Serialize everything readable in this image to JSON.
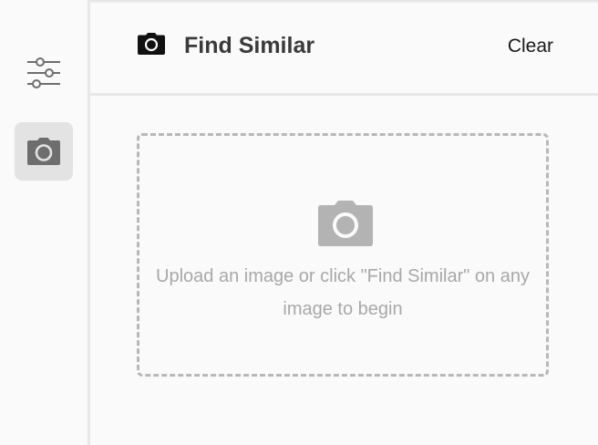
{
  "header": {
    "title": "Find Similar",
    "clear_label": "Clear",
    "icon": "camera-icon"
  },
  "rail": {
    "items": [
      {
        "icon": "sliders-icon",
        "active": false
      },
      {
        "icon": "camera-icon",
        "active": true
      }
    ]
  },
  "dropzone": {
    "icon": "camera-icon",
    "message": "Upload an image or click \"Find Similar\" on any image to begin"
  },
  "colors": {
    "background": "#fafafa",
    "active_rail_bg": "#e3e3e3",
    "dropzone_border": "#b8b8b8",
    "placeholder_text": "#a8a8a8",
    "icon_muted": "#6e6e6e"
  }
}
